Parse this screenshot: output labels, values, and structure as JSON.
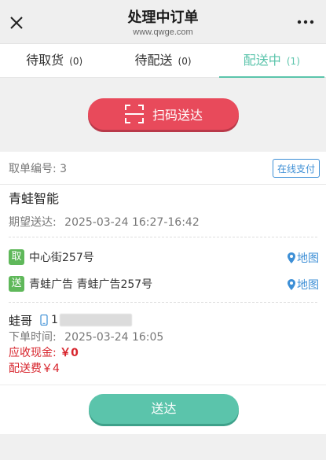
{
  "header": {
    "title": "处理中订单",
    "subtitle": "www.qwge.com",
    "close_icon": "close-icon",
    "more_icon": "more-icon"
  },
  "tabs": [
    {
      "label": "待取货",
      "count": "(0)",
      "active": false
    },
    {
      "label": "待配送",
      "count": "(0)",
      "active": false
    },
    {
      "label": "配送中",
      "count": "(1)",
      "active": true
    }
  ],
  "scan_button": {
    "label": "扫码送达",
    "icon": "scan-icon"
  },
  "order": {
    "pickup_no_label": "取单编号: 3",
    "online_pay_label": "在线支付",
    "shop_name": "青蛙智能",
    "expect_label": "期望送达:",
    "expect_value": "2025-03-24 16:27-16:42",
    "pickup": {
      "tag": "取",
      "address": "中心街257号",
      "map_label": "地图"
    },
    "delivery": {
      "tag": "送",
      "address": "青蛙广告 青蛙广告257号",
      "map_label": "地图"
    },
    "customer_name": "蛙哥",
    "customer_phone_visible": "1",
    "order_time_label": "下单时间:",
    "order_time_value": "2025-03-24 16:05",
    "cash_label": "应收现金:",
    "cash_value": "￥0",
    "fee_label": "配送费￥4"
  },
  "deliver_button": {
    "label": "送达"
  },
  "colors": {
    "accent_green": "#5bc4ab",
    "scan_red": "#e84a5b",
    "link_blue": "#3d8fd6",
    "tag_green": "#5fb85a",
    "money_red": "#d7242c"
  }
}
